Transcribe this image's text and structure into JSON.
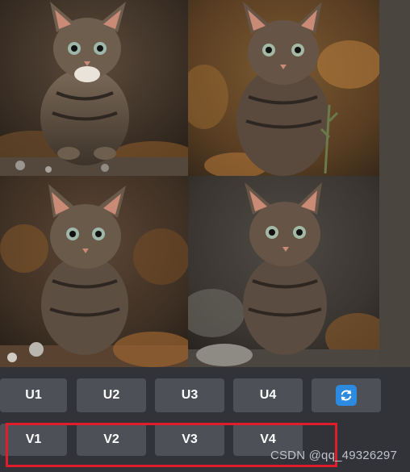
{
  "images": [
    {
      "alt": "kitten-1"
    },
    {
      "alt": "kitten-2"
    },
    {
      "alt": "kitten-3"
    },
    {
      "alt": "kitten-4"
    }
  ],
  "upscale_buttons": [
    {
      "label": "U1"
    },
    {
      "label": "U2"
    },
    {
      "label": "U3"
    },
    {
      "label": "U4"
    }
  ],
  "reroll_button": {
    "icon": "refresh-icon",
    "color": "#2c8be0"
  },
  "variation_buttons": [
    {
      "label": "V1"
    },
    {
      "label": "V2"
    },
    {
      "label": "V3"
    },
    {
      "label": "V4"
    }
  ],
  "highlight": {
    "color": "#e11d2b"
  },
  "watermark": "CSDN @qq_49326297"
}
